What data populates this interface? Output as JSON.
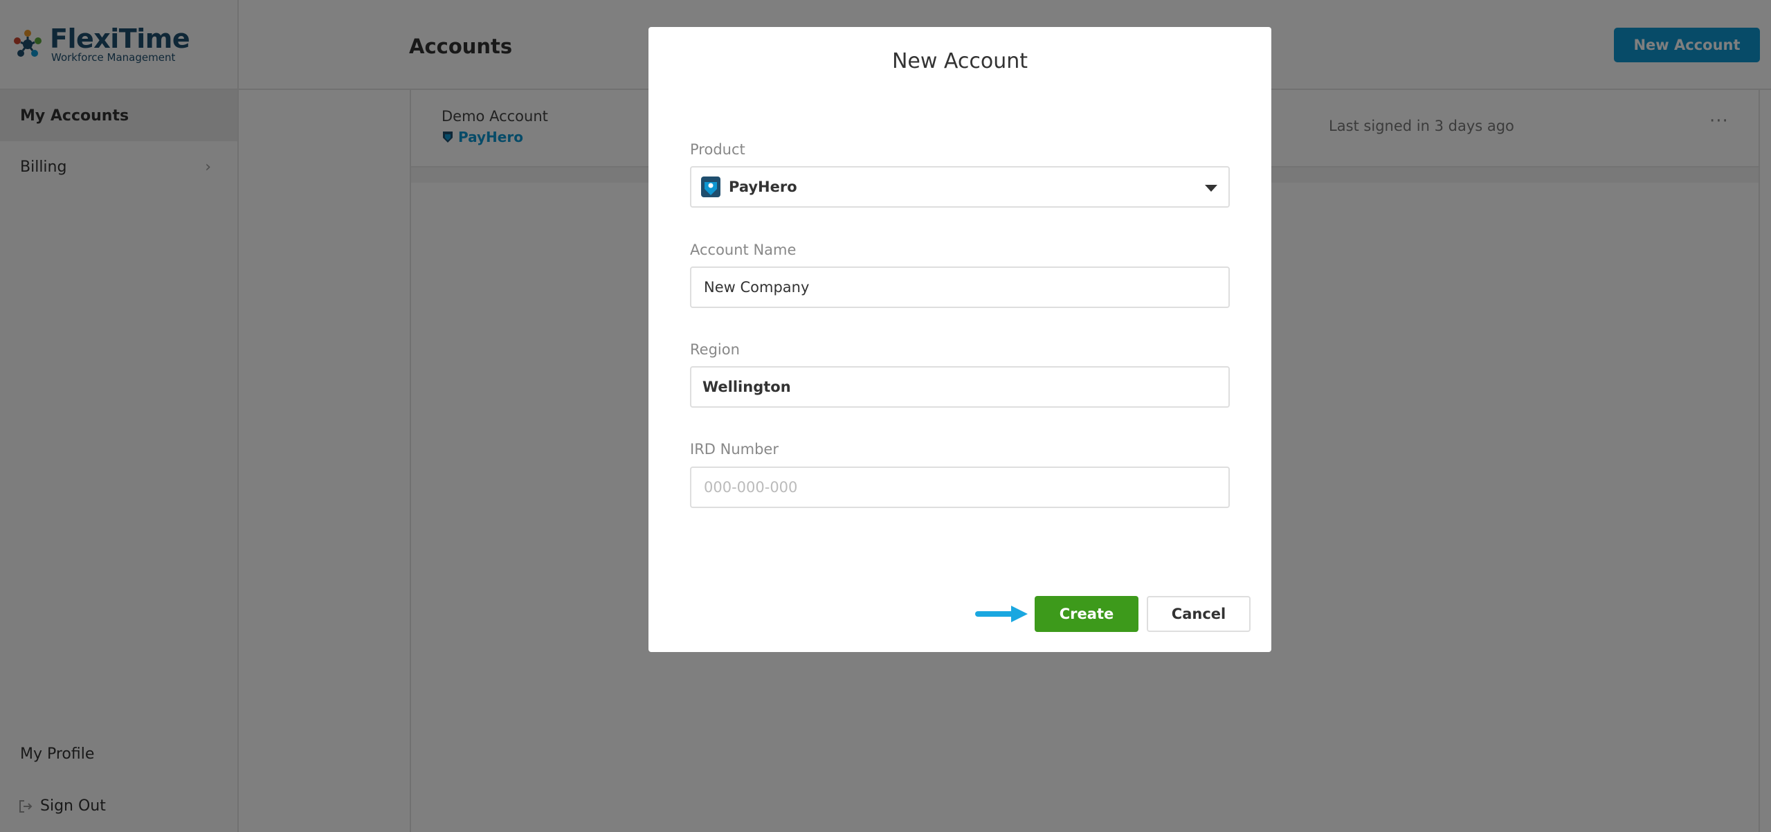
{
  "brand": {
    "name": "FlexiTime",
    "tagline": "Workforce Management",
    "colors": {
      "primary": "#1f4e6e",
      "accent": "#0f96d1",
      "success": "#3d9a1b"
    }
  },
  "sidebar": {
    "items": [
      {
        "label": "My Accounts",
        "active": true
      },
      {
        "label": "Billing",
        "icon": "chevron-right-icon"
      }
    ],
    "bottom_items": [
      {
        "label": "My Profile"
      },
      {
        "label": "Sign Out",
        "icon": "sign-out-icon"
      }
    ]
  },
  "header": {
    "title": "Accounts",
    "new_account_label": "New Account"
  },
  "accounts": [
    {
      "name": "Demo Account",
      "product": "PayHero",
      "last_signed": "Last signed in 3 days ago",
      "menu_icon": "more-icon"
    }
  ],
  "modal": {
    "title": "New Account",
    "product": {
      "label": "Product",
      "value": "PayHero",
      "icon": "payhero-icon"
    },
    "account_name": {
      "label": "Account Name",
      "value": "New Company"
    },
    "region": {
      "label": "Region",
      "value": "Wellington"
    },
    "ird": {
      "label": "IRD Number",
      "placeholder": "000-000-000",
      "value": ""
    },
    "create_label": "Create",
    "cancel_label": "Cancel"
  }
}
